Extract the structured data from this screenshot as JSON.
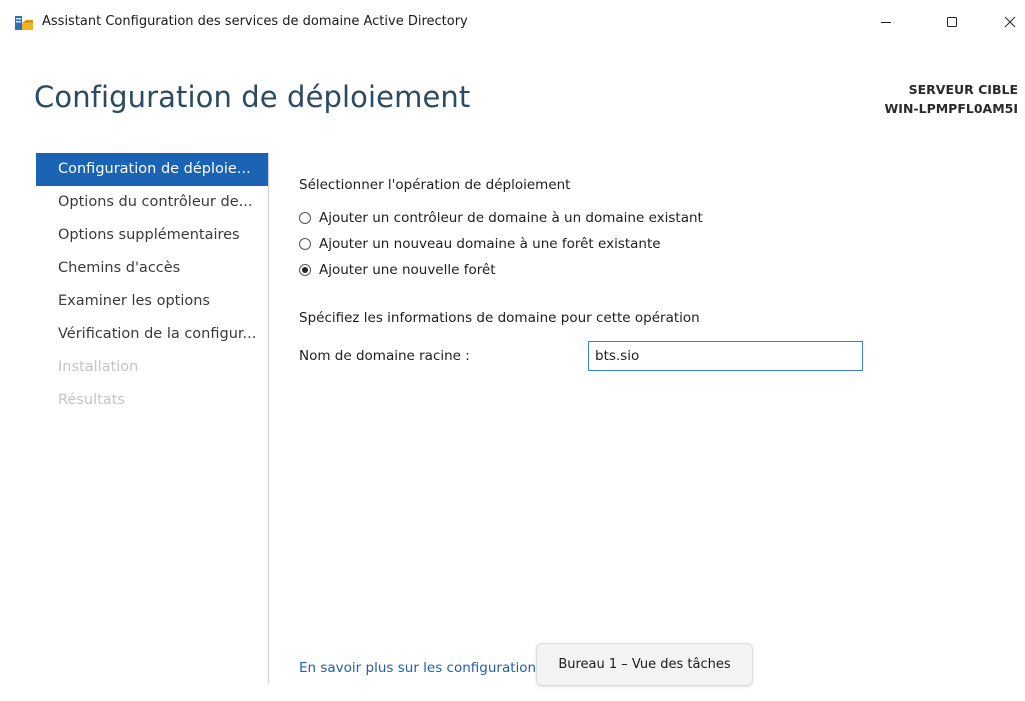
{
  "window": {
    "title": "Assistant Configuration des services de domaine Active Directory"
  },
  "header": {
    "page_title": "Configuration de déploiement",
    "server_label": "SERVEUR CIBLE",
    "server_name": "WIN-LPMPFL0AM5I"
  },
  "sidebar": {
    "items": [
      {
        "label": "Configuration de déploie...",
        "state": "active"
      },
      {
        "label": "Options du contrôleur de...",
        "state": "enabled"
      },
      {
        "label": "Options supplémentaires",
        "state": "enabled"
      },
      {
        "label": "Chemins d'accès",
        "state": "enabled"
      },
      {
        "label": "Examiner les options",
        "state": "enabled"
      },
      {
        "label": "Vérification de la configur...",
        "state": "enabled"
      },
      {
        "label": "Installation",
        "state": "disabled"
      },
      {
        "label": "Résultats",
        "state": "disabled"
      }
    ]
  },
  "main": {
    "operation_heading": "Sélectionner l'opération de déploiement",
    "options": [
      {
        "label": "Ajouter un contrôleur de domaine à un domaine existant",
        "selected": false
      },
      {
        "label": "Ajouter un nouveau domaine à une forêt existante",
        "selected": false
      },
      {
        "label": "Ajouter une nouvelle forêt",
        "selected": true
      }
    ],
    "domain_heading": "Spécifiez les informations de domaine pour cette opération",
    "root_domain_label": "Nom de domaine racine :",
    "root_domain_value": "bts.sio",
    "learn_more_link": "En savoir plus sur les configurations de déploiement"
  },
  "tooltip": {
    "text": "Bureau 1 – Vue des tâches"
  },
  "colors": {
    "accent": "#1a63b5",
    "title_color": "#2b4a63",
    "link": "#1f5fb0"
  }
}
